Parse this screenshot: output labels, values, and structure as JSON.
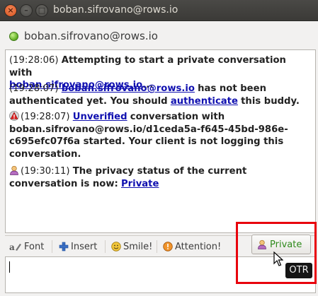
{
  "window": {
    "title": "boban.sifrovano@rows.io"
  },
  "header": {
    "buddy_name": "boban.sifrovano@rows.io"
  },
  "conversation": {
    "messages": [
      {
        "time": "(19:28:06)",
        "text_bold": "Attempting to start a private conversation with",
        "link": "boban.sifrovano@rows.io",
        "suffix": "..."
      },
      {
        "time": "(19:28:07)",
        "link1": "boban.sifrovano@rows.io",
        "text_mid": "has not been authenticated yet.  You should",
        "link2": "authenticate",
        "text_end": "this buddy."
      },
      {
        "time": "(19:28:07)",
        "link": "Unverified",
        "text": "conversation with boban.sifrovano@rows.io/d1ceda5a-f645-45bd-986e-c695efc07f6a started.  Your client is not logging this conversation."
      },
      {
        "time": "(19:30:11)",
        "text_bold": "The privacy status of the current conversation is now:",
        "link": "Private"
      }
    ]
  },
  "toolbar": {
    "font_label": "Font",
    "insert_label": "Insert",
    "smile_label": "Smile!",
    "attention_label": "Attention!",
    "private_label": "Private"
  },
  "tooltip": {
    "text": "OTR"
  },
  "colors": {
    "link": "#1010b0",
    "private_green": "#2f8a1c",
    "highlight_red": "#e8000c",
    "status_online": "#5fae23"
  }
}
